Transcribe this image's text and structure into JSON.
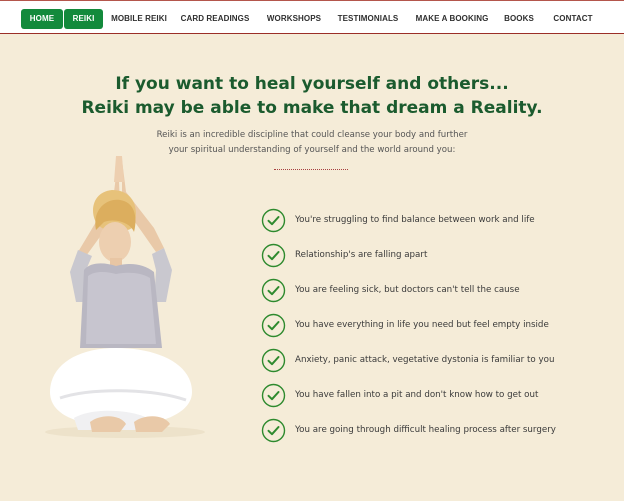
{
  "nav": {
    "items": [
      {
        "label": "HOME"
      },
      {
        "label": "REIKI"
      },
      {
        "label": "MOBILE REIKI"
      },
      {
        "label": "CARD READINGS"
      },
      {
        "label": "WORKSHOPS"
      },
      {
        "label": "TESTIMONIALS"
      },
      {
        "label": "MAKE A BOOKING"
      },
      {
        "label": "BOOKS"
      },
      {
        "label": "CONTACT"
      }
    ],
    "active_color": "#138a3c",
    "border_color": "#9b2f28"
  },
  "hero": {
    "headline_line1": "If you want to heal yourself and others...",
    "headline_line2": "Reiki may be able to make that dream a Reality.",
    "intro_line1": "Reiki is an incredible discipline that could cleanse your body and further",
    "intro_line2": "your spiritual understanding of yourself and the world around you:",
    "headline_color": "#1b5b2e"
  },
  "checklist": {
    "icon": "check-circle-icon",
    "color": "#2e8a2e",
    "items": [
      {
        "text": "You're struggling to find balance between work and life"
      },
      {
        "text": "Relationship's are falling apart"
      },
      {
        "text": "You are feeling sick, but doctors can't tell the cause"
      },
      {
        "text": "You have everything in life you need but feel empty inside"
      },
      {
        "text": "Anxiety, panic attack, vegetative dystonia is familiar to you"
      },
      {
        "text": "You have fallen into a pit and don't know how to get out"
      },
      {
        "text": "You are going through difficult healing process after surgery"
      }
    ]
  },
  "colors": {
    "page_background": "#f5ecd8",
    "accent": "#138a3c"
  }
}
